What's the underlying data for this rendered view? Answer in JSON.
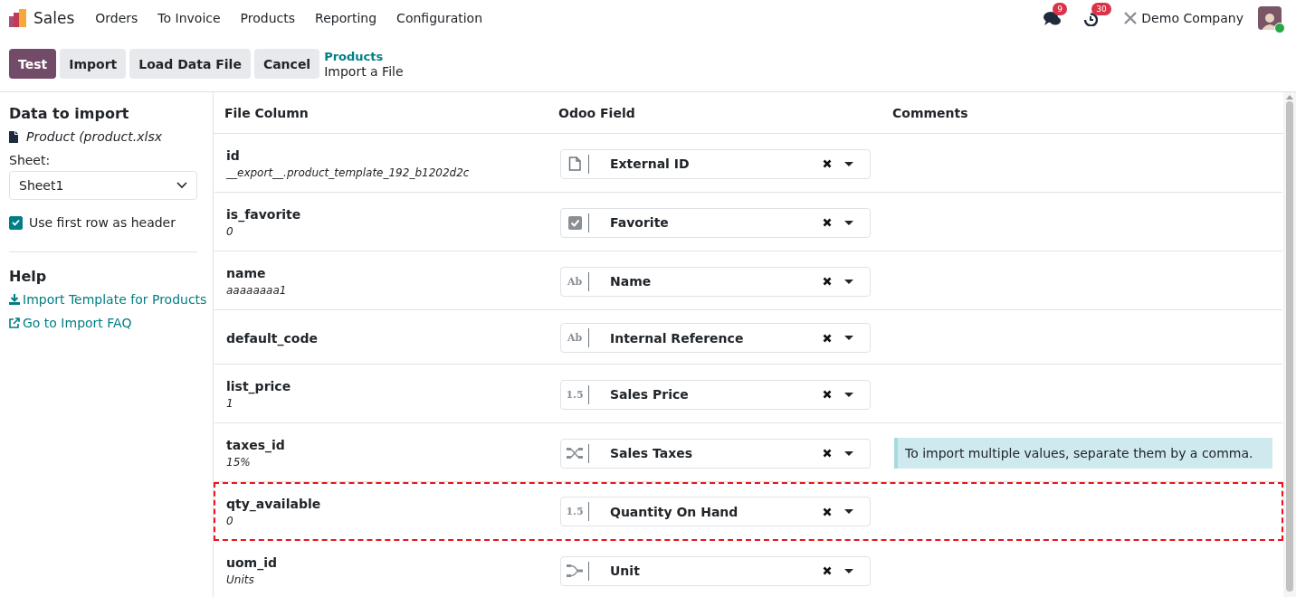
{
  "navbar": {
    "app_name": "Sales",
    "menu": [
      "Orders",
      "To Invoice",
      "Products",
      "Reporting",
      "Configuration"
    ],
    "messages_count": "9",
    "activities_count": "30",
    "company": "Demo Company",
    "user_online": true
  },
  "control_panel": {
    "buttons": [
      {
        "label": "Test",
        "primary": true
      },
      {
        "label": "Import",
        "primary": false
      },
      {
        "label": "Load Data File",
        "primary": false
      },
      {
        "label": "Cancel",
        "primary": false
      }
    ],
    "breadcrumb": "Products",
    "title": "Import a File"
  },
  "sidebar": {
    "heading": "Data to import",
    "file_name": "Product (product.xlsx",
    "sheet_label": "Sheet:",
    "sheet_value": "Sheet1",
    "header_option": {
      "label": "Use first row as header",
      "checked": true
    },
    "help_heading": "Help",
    "links": [
      {
        "kind": "download",
        "label": "Import Template for Products"
      },
      {
        "kind": "external",
        "label": "Go to Import FAQ"
      }
    ]
  },
  "table": {
    "columns": [
      "File Column",
      "Odoo Field",
      "Comments"
    ],
    "rows": [
      {
        "column": "id",
        "sample": "__export__.product_template_192_b1202d2c",
        "field": "External ID",
        "kind": "file",
        "highlighted": false
      },
      {
        "column": "is_favorite",
        "sample": "0",
        "field": "Favorite",
        "kind": "boolean",
        "highlighted": false
      },
      {
        "column": "name",
        "sample": "aaaaaaaa1",
        "field": "Name",
        "kind": "text",
        "type_text": "Ab",
        "highlighted": false
      },
      {
        "column": "default_code",
        "field": "Internal Reference",
        "kind": "text",
        "type_text": "Ab",
        "highlighted": false
      },
      {
        "column": "list_price",
        "sample": "1",
        "field": "Sales Price",
        "kind": "text",
        "type_text": "1.5",
        "highlighted": false
      },
      {
        "column": "taxes_id",
        "sample": "15%",
        "field": "Sales Taxes",
        "kind": "many2many",
        "comment": "To import multiple values, separate them by a comma.",
        "highlighted": false
      },
      {
        "column": "qty_available",
        "sample": "0",
        "field": "Quantity On Hand",
        "kind": "text",
        "type_text": "1.5",
        "highlighted": true
      },
      {
        "column": "uom_id",
        "sample": "Units",
        "field": "Unit",
        "kind": "many2one",
        "highlighted": false
      }
    ]
  }
}
